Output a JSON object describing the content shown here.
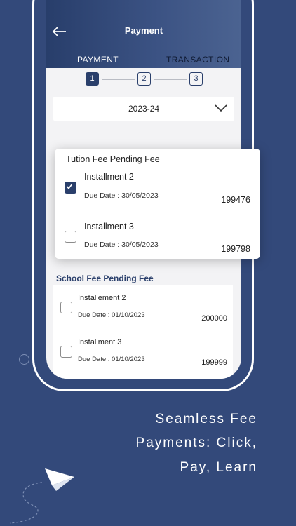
{
  "header": {
    "back_icon": "back-arrow-icon",
    "title": "Payment"
  },
  "tabs": [
    {
      "label": "PAYMENT",
      "active": true
    },
    {
      "label": "TRANSACTION",
      "active": false
    }
  ],
  "steps": [
    {
      "label": "1",
      "active": true
    },
    {
      "label": "2",
      "active": false
    },
    {
      "label": "3",
      "active": false
    }
  ],
  "year_select": {
    "value": "2023-24",
    "icon": "chevron-down-icon"
  },
  "tution_fee": {
    "title": "Tution Fee Pending Fee",
    "items": [
      {
        "name": "Installment 2",
        "due": "Due Date : 30/05/2023",
        "amount": "199476",
        "checked": true
      },
      {
        "name": "Installment 3",
        "due": "Due Date : 30/05/2023",
        "amount": "199798",
        "checked": false
      }
    ]
  },
  "school_fee": {
    "title": "School Fee Pending Fee",
    "items": [
      {
        "name": "Installement 2",
        "due": "Due Date : 01/10/2023",
        "amount": "200000",
        "checked": false
      },
      {
        "name": "Installment 3",
        "due": "Due Date : 01/10/2023",
        "amount": "199999",
        "checked": false
      }
    ]
  },
  "tagline": {
    "line1": "Seamless Fee",
    "line2": "Payments: Click,",
    "line3": "Pay, Learn"
  },
  "colors": {
    "background": "#33497a",
    "primary": "#2a3f6b",
    "card": "#ffffff"
  }
}
